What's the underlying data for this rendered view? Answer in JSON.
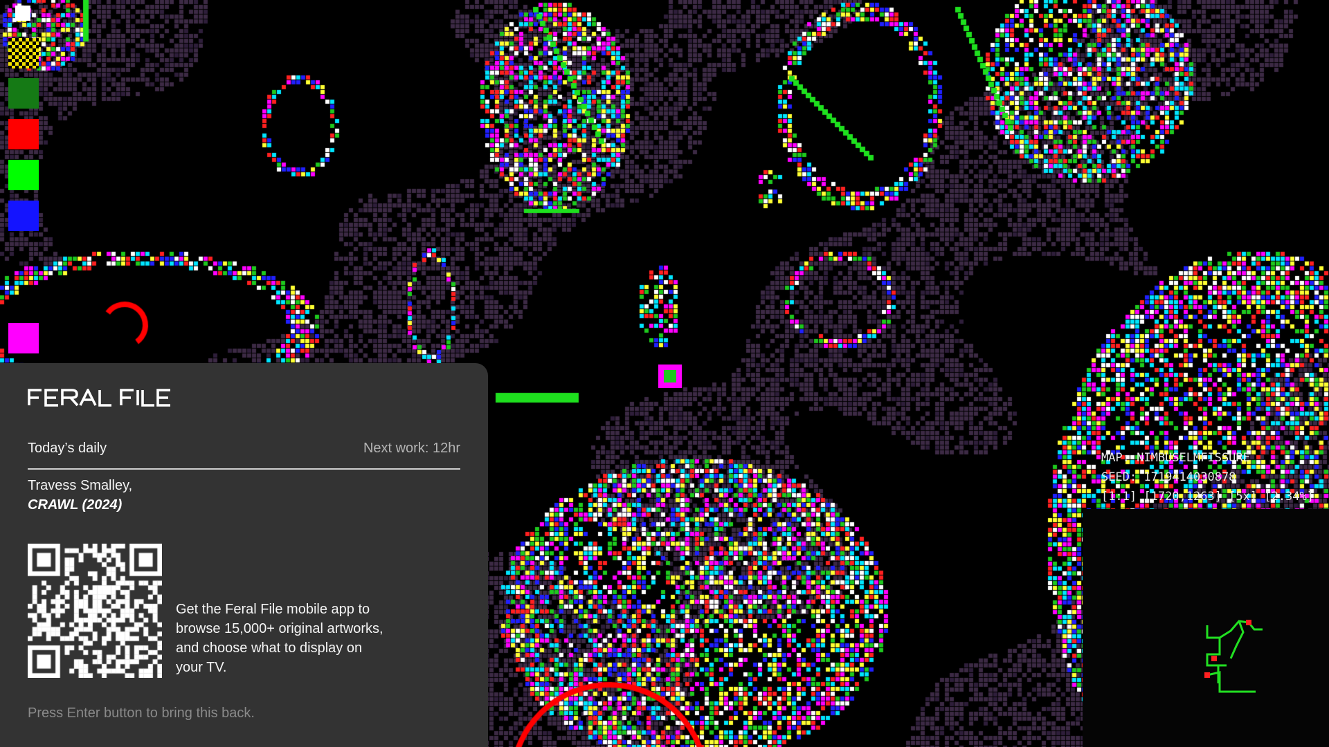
{
  "palette": {
    "swatches": [
      {
        "name": "white",
        "color": "#ffffff"
      },
      {
        "name": "checker",
        "color": "#f2e000"
      },
      {
        "name": "dark-green",
        "color": "#157a15"
      },
      {
        "name": "red",
        "color": "#ff0000"
      },
      {
        "name": "green",
        "color": "#00ff00"
      },
      {
        "name": "blue",
        "color": "#1414ff"
      },
      {
        "name": "magenta",
        "color": "#ff00ff"
      }
    ]
  },
  "map_info": {
    "map": "MAP: NIMBUSELMFISSURE",
    "seed": "SEED: 1719414030878",
    "view": "[1:1] [1720,1263] [5x] [2.34%]"
  },
  "panel": {
    "brand": "FERAL FILE",
    "today_label": "Today’s daily",
    "next_label": "Next work: 12hr",
    "artist": "Travess Smalley,",
    "work_title": "CRAWL (2024)",
    "app_message": "Get the Feral File mobile app to browse 15,000+ original artworks, and choose what to display on your TV.",
    "hint": "Press Enter button to bring this back."
  },
  "colors": {
    "panel_bg": "#333333",
    "maze": "#3c2a44",
    "accent_green": "#00ff00",
    "accent_red": "#ff0000",
    "accent_magenta": "#ff00ff"
  }
}
